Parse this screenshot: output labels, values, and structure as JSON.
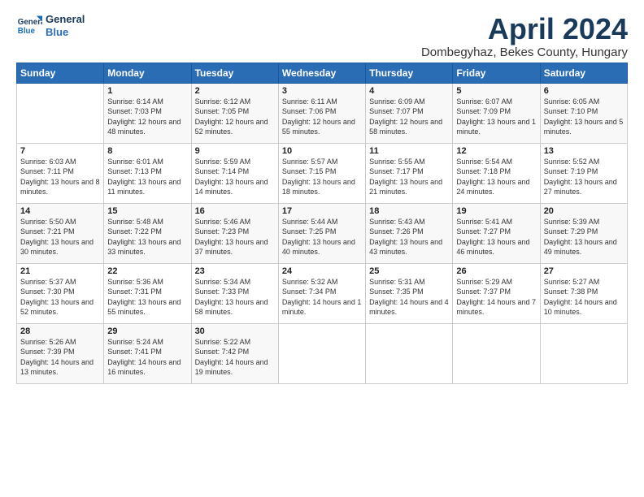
{
  "header": {
    "logo_line1": "General",
    "logo_line2": "Blue",
    "title": "April 2024",
    "location": "Dombegyhaz, Bekes County, Hungary"
  },
  "weekdays": [
    "Sunday",
    "Monday",
    "Tuesday",
    "Wednesday",
    "Thursday",
    "Friday",
    "Saturday"
  ],
  "weeks": [
    [
      {
        "day": "",
        "sunrise": "",
        "sunset": "",
        "daylight": ""
      },
      {
        "day": "1",
        "sunrise": "Sunrise: 6:14 AM",
        "sunset": "Sunset: 7:03 PM",
        "daylight": "Daylight: 12 hours and 48 minutes."
      },
      {
        "day": "2",
        "sunrise": "Sunrise: 6:12 AM",
        "sunset": "Sunset: 7:05 PM",
        "daylight": "Daylight: 12 hours and 52 minutes."
      },
      {
        "day": "3",
        "sunrise": "Sunrise: 6:11 AM",
        "sunset": "Sunset: 7:06 PM",
        "daylight": "Daylight: 12 hours and 55 minutes."
      },
      {
        "day": "4",
        "sunrise": "Sunrise: 6:09 AM",
        "sunset": "Sunset: 7:07 PM",
        "daylight": "Daylight: 12 hours and 58 minutes."
      },
      {
        "day": "5",
        "sunrise": "Sunrise: 6:07 AM",
        "sunset": "Sunset: 7:09 PM",
        "daylight": "Daylight: 13 hours and 1 minute."
      },
      {
        "day": "6",
        "sunrise": "Sunrise: 6:05 AM",
        "sunset": "Sunset: 7:10 PM",
        "daylight": "Daylight: 13 hours and 5 minutes."
      }
    ],
    [
      {
        "day": "7",
        "sunrise": "Sunrise: 6:03 AM",
        "sunset": "Sunset: 7:11 PM",
        "daylight": "Daylight: 13 hours and 8 minutes."
      },
      {
        "day": "8",
        "sunrise": "Sunrise: 6:01 AM",
        "sunset": "Sunset: 7:13 PM",
        "daylight": "Daylight: 13 hours and 11 minutes."
      },
      {
        "day": "9",
        "sunrise": "Sunrise: 5:59 AM",
        "sunset": "Sunset: 7:14 PM",
        "daylight": "Daylight: 13 hours and 14 minutes."
      },
      {
        "day": "10",
        "sunrise": "Sunrise: 5:57 AM",
        "sunset": "Sunset: 7:15 PM",
        "daylight": "Daylight: 13 hours and 18 minutes."
      },
      {
        "day": "11",
        "sunrise": "Sunrise: 5:55 AM",
        "sunset": "Sunset: 7:17 PM",
        "daylight": "Daylight: 13 hours and 21 minutes."
      },
      {
        "day": "12",
        "sunrise": "Sunrise: 5:54 AM",
        "sunset": "Sunset: 7:18 PM",
        "daylight": "Daylight: 13 hours and 24 minutes."
      },
      {
        "day": "13",
        "sunrise": "Sunrise: 5:52 AM",
        "sunset": "Sunset: 7:19 PM",
        "daylight": "Daylight: 13 hours and 27 minutes."
      }
    ],
    [
      {
        "day": "14",
        "sunrise": "Sunrise: 5:50 AM",
        "sunset": "Sunset: 7:21 PM",
        "daylight": "Daylight: 13 hours and 30 minutes."
      },
      {
        "day": "15",
        "sunrise": "Sunrise: 5:48 AM",
        "sunset": "Sunset: 7:22 PM",
        "daylight": "Daylight: 13 hours and 33 minutes."
      },
      {
        "day": "16",
        "sunrise": "Sunrise: 5:46 AM",
        "sunset": "Sunset: 7:23 PM",
        "daylight": "Daylight: 13 hours and 37 minutes."
      },
      {
        "day": "17",
        "sunrise": "Sunrise: 5:44 AM",
        "sunset": "Sunset: 7:25 PM",
        "daylight": "Daylight: 13 hours and 40 minutes."
      },
      {
        "day": "18",
        "sunrise": "Sunrise: 5:43 AM",
        "sunset": "Sunset: 7:26 PM",
        "daylight": "Daylight: 13 hours and 43 minutes."
      },
      {
        "day": "19",
        "sunrise": "Sunrise: 5:41 AM",
        "sunset": "Sunset: 7:27 PM",
        "daylight": "Daylight: 13 hours and 46 minutes."
      },
      {
        "day": "20",
        "sunrise": "Sunrise: 5:39 AM",
        "sunset": "Sunset: 7:29 PM",
        "daylight": "Daylight: 13 hours and 49 minutes."
      }
    ],
    [
      {
        "day": "21",
        "sunrise": "Sunrise: 5:37 AM",
        "sunset": "Sunset: 7:30 PM",
        "daylight": "Daylight: 13 hours and 52 minutes."
      },
      {
        "day": "22",
        "sunrise": "Sunrise: 5:36 AM",
        "sunset": "Sunset: 7:31 PM",
        "daylight": "Daylight: 13 hours and 55 minutes."
      },
      {
        "day": "23",
        "sunrise": "Sunrise: 5:34 AM",
        "sunset": "Sunset: 7:33 PM",
        "daylight": "Daylight: 13 hours and 58 minutes."
      },
      {
        "day": "24",
        "sunrise": "Sunrise: 5:32 AM",
        "sunset": "Sunset: 7:34 PM",
        "daylight": "Daylight: 14 hours and 1 minute."
      },
      {
        "day": "25",
        "sunrise": "Sunrise: 5:31 AM",
        "sunset": "Sunset: 7:35 PM",
        "daylight": "Daylight: 14 hours and 4 minutes."
      },
      {
        "day": "26",
        "sunrise": "Sunrise: 5:29 AM",
        "sunset": "Sunset: 7:37 PM",
        "daylight": "Daylight: 14 hours and 7 minutes."
      },
      {
        "day": "27",
        "sunrise": "Sunrise: 5:27 AM",
        "sunset": "Sunset: 7:38 PM",
        "daylight": "Daylight: 14 hours and 10 minutes."
      }
    ],
    [
      {
        "day": "28",
        "sunrise": "Sunrise: 5:26 AM",
        "sunset": "Sunset: 7:39 PM",
        "daylight": "Daylight: 14 hours and 13 minutes."
      },
      {
        "day": "29",
        "sunrise": "Sunrise: 5:24 AM",
        "sunset": "Sunset: 7:41 PM",
        "daylight": "Daylight: 14 hours and 16 minutes."
      },
      {
        "day": "30",
        "sunrise": "Sunrise: 5:22 AM",
        "sunset": "Sunset: 7:42 PM",
        "daylight": "Daylight: 14 hours and 19 minutes."
      },
      {
        "day": "",
        "sunrise": "",
        "sunset": "",
        "daylight": ""
      },
      {
        "day": "",
        "sunrise": "",
        "sunset": "",
        "daylight": ""
      },
      {
        "day": "",
        "sunrise": "",
        "sunset": "",
        "daylight": ""
      },
      {
        "day": "",
        "sunrise": "",
        "sunset": "",
        "daylight": ""
      }
    ]
  ]
}
